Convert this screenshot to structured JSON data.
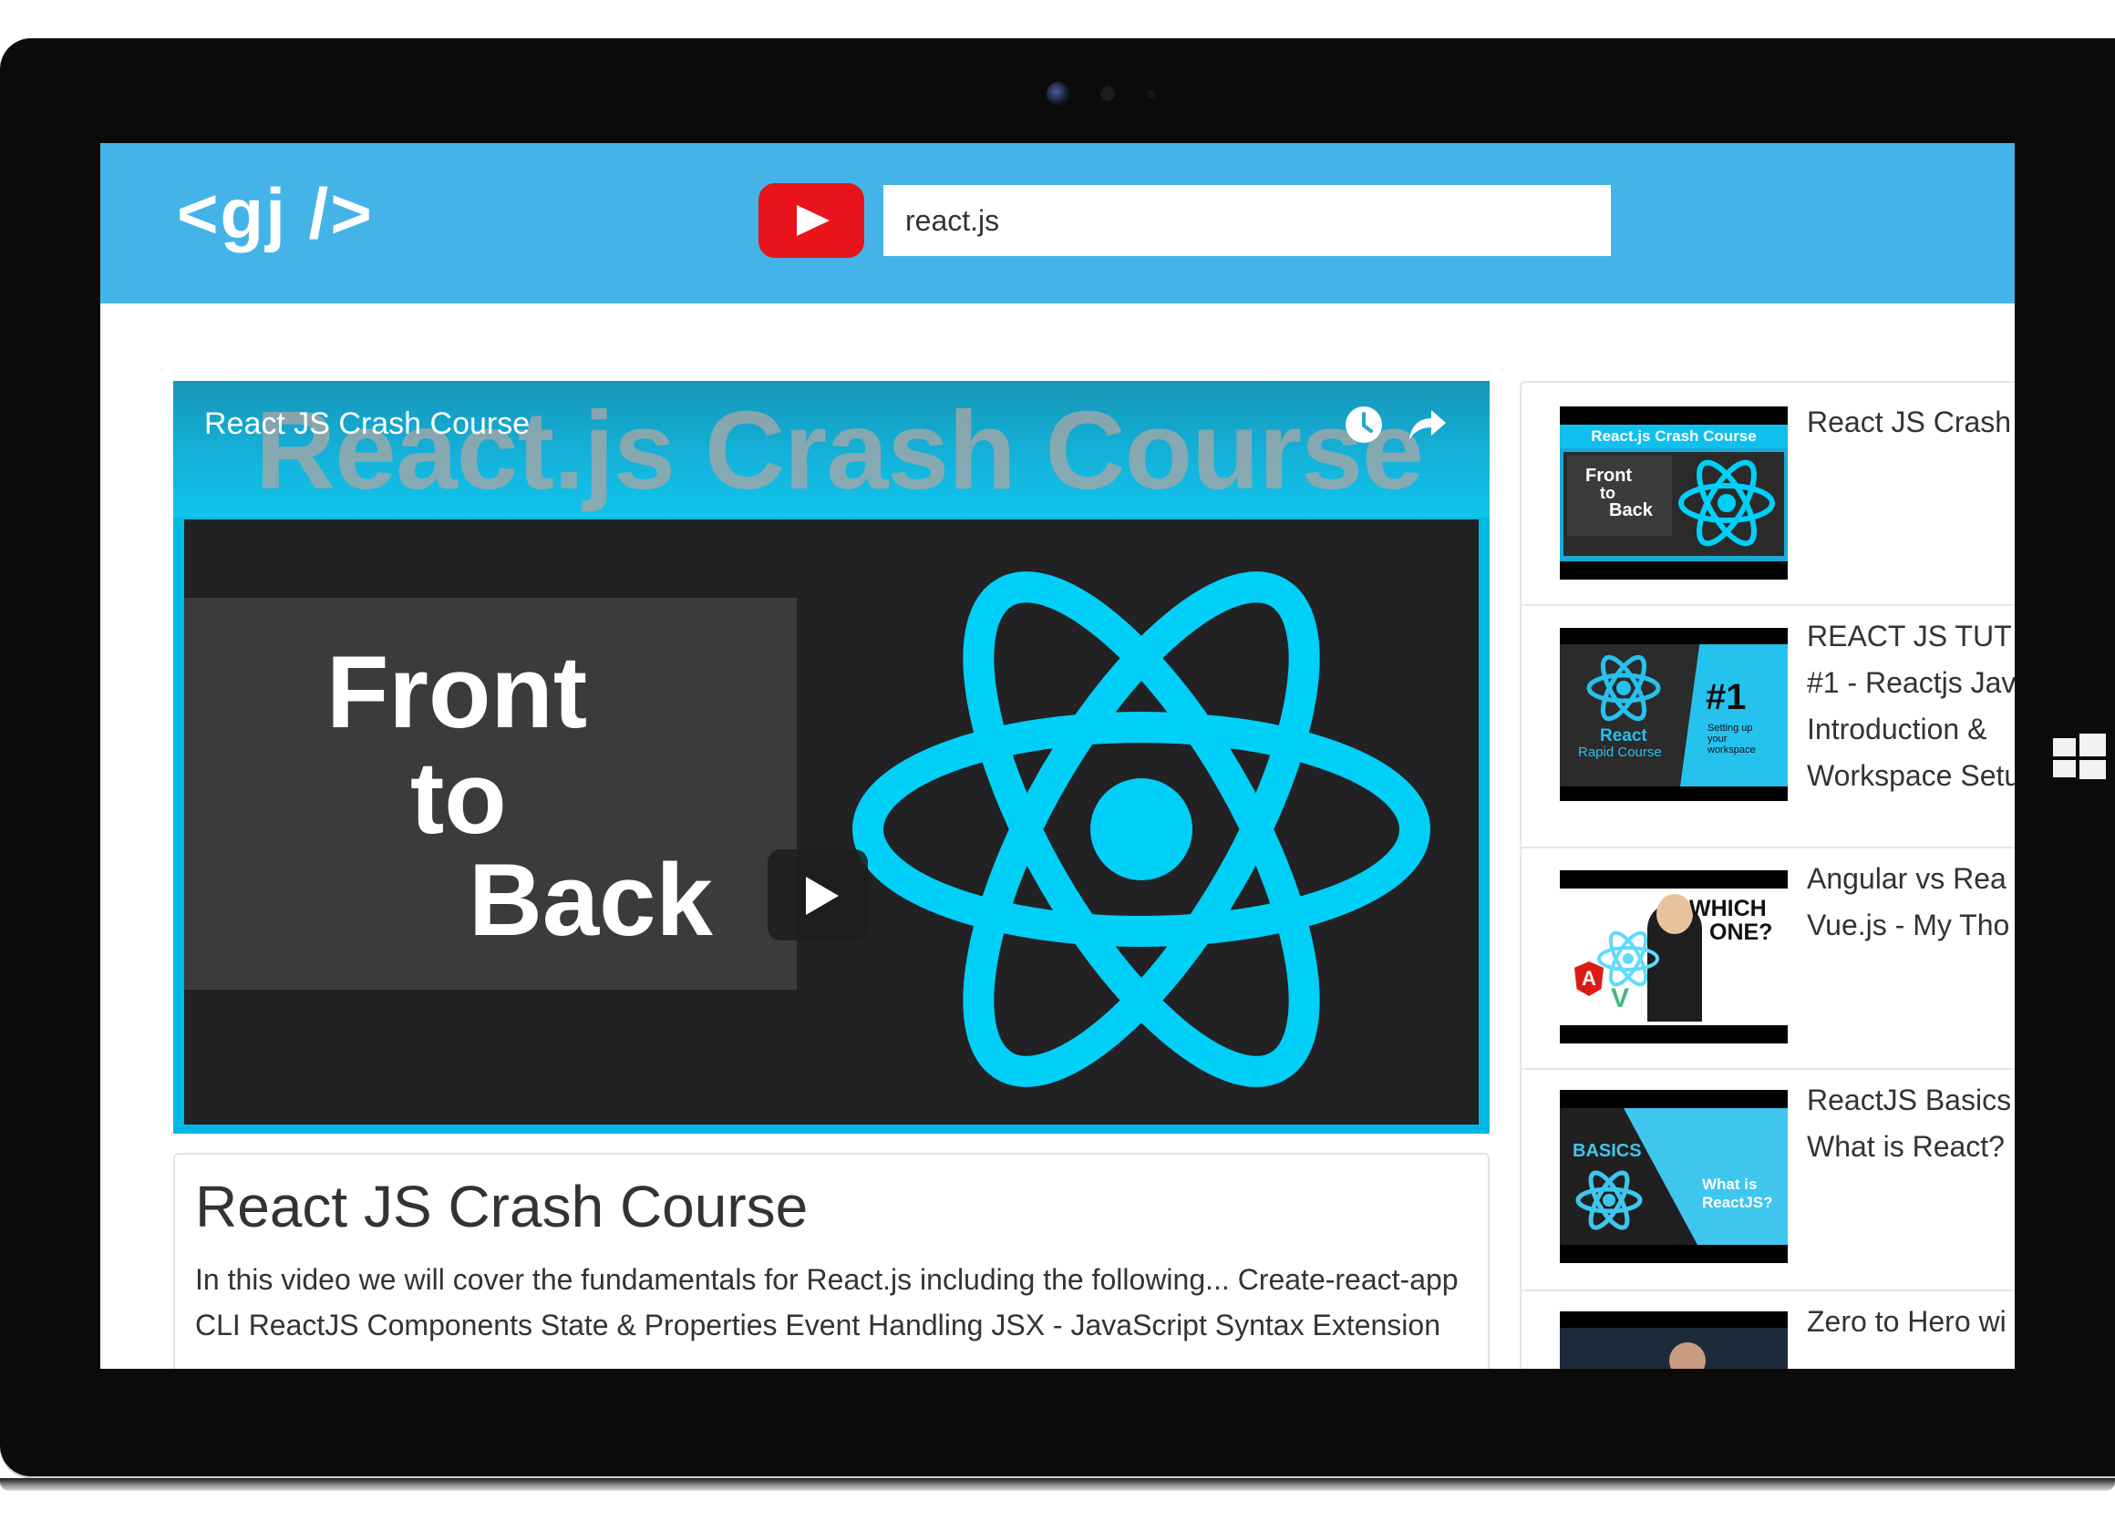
{
  "app": {
    "logo": "<gj />"
  },
  "search": {
    "value": "react.js"
  },
  "player": {
    "overlay_title": "React JS Crash Course",
    "thumbnail_heading": "React.js Crash Course",
    "thumbnail_lines": [
      "Front",
      "to",
      "Back"
    ]
  },
  "video": {
    "title": "React JS Crash Course",
    "description": "In this video we will cover the fundamentals for React.js including the following... Create-react-app CLI ReactJS Components State & Properties Event Handling JSX - JavaScript Syntax Extension"
  },
  "sidebar": {
    "items": [
      {
        "title_lines": [
          "React JS Crash"
        ],
        "thumb_text": [
          "React.js Crash Course",
          "Front",
          "to",
          "Back"
        ]
      },
      {
        "title_lines": [
          "REACT JS TUT",
          "#1 - Reactjs Jav",
          "Introduction &",
          "Workspace Setu"
        ],
        "thumb_text": [
          "React",
          "Rapid Course",
          "#1",
          "Setting up",
          "your",
          "workspace"
        ]
      },
      {
        "title_lines": [
          "Angular vs Rea",
          "Vue.js - My Tho"
        ],
        "thumb_text": [
          "WHICH",
          "ONE?",
          "A",
          "V"
        ]
      },
      {
        "title_lines": [
          "ReactJS Basics",
          "What is React?"
        ],
        "thumb_text": [
          "BASICS",
          "What is",
          "ReactJS?"
        ]
      },
      {
        "title_lines": [
          "Zero to Hero wi"
        ],
        "thumb_text": []
      }
    ]
  },
  "colors": {
    "header": "#44b4e8",
    "youtube_red": "#e8131b",
    "react_cyan": "#00d0f8"
  }
}
